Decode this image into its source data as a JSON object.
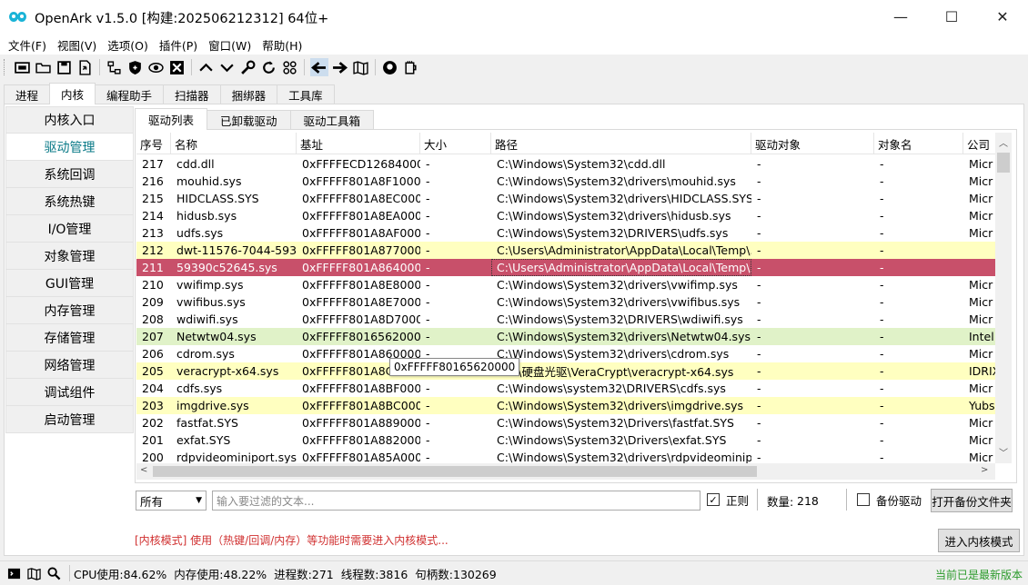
{
  "title": "OpenArk v1.5.0 [构建:202506212312]  64位+",
  "menu": [
    "文件(F)",
    "视图(V)",
    "选项(O)",
    "插件(P)",
    "窗口(W)",
    "帮助(H)"
  ],
  "main_tabs": [
    "进程",
    "内核",
    "编程助手",
    "扫描器",
    "捆绑器",
    "工具库"
  ],
  "main_tab_active": 1,
  "nav": [
    "内核入口",
    "驱动管理",
    "系统回调",
    "系统热键",
    "I/O管理",
    "对象管理",
    "GUI管理",
    "内存管理",
    "存储管理",
    "网络管理",
    "调试组件",
    "启动管理"
  ],
  "nav_active": 1,
  "sub_tabs": [
    "驱动列表",
    "已卸载驱动",
    "驱动工具箱"
  ],
  "sub_tab_active": 0,
  "columns": [
    "序号",
    "名称",
    "基址",
    "大小",
    "路径",
    "驱动对象",
    "对象名",
    "公司"
  ],
  "rows": [
    {
      "no": "217",
      "name": "cdd.dll",
      "base": "0xFFFFECD126840000",
      "size": "-",
      "path": "C:\\Windows\\System32\\cdd.dll",
      "obj": "-",
      "oname": "-",
      "co": "Micr",
      "hl": ""
    },
    {
      "no": "216",
      "name": "mouhid.sys",
      "base": "0xFFFFF801A8F10000",
      "size": "-",
      "path": "C:\\Windows\\System32\\drivers\\mouhid.sys",
      "obj": "-",
      "oname": "-",
      "co": "Micr",
      "hl": ""
    },
    {
      "no": "215",
      "name": "HIDCLASS.SYS",
      "base": "0xFFFFF801A8EC0000",
      "size": "-",
      "path": "C:\\Windows\\System32\\drivers\\HIDCLASS.SYS",
      "obj": "-",
      "oname": "-",
      "co": "Micr",
      "hl": ""
    },
    {
      "no": "214",
      "name": "hidusb.sys",
      "base": "0xFFFFF801A8EA0000",
      "size": "-",
      "path": "C:\\Windows\\System32\\drivers\\hidusb.sys",
      "obj": "-",
      "oname": "-",
      "co": "Micr",
      "hl": ""
    },
    {
      "no": "213",
      "name": "udfs.sys",
      "base": "0xFFFFF801A8AF0000",
      "size": "-",
      "path": "C:\\Windows\\System32\\DRIVERS\\udfs.sys",
      "obj": "-",
      "oname": "-",
      "co": "Micr",
      "hl": ""
    },
    {
      "no": "212",
      "name": "dwt-11576-7044-593...",
      "base": "0xFFFFF801A8770000",
      "size": "-",
      "path": "C:\\Users\\Administrator\\AppData\\Local\\Temp\\...",
      "obj": "-",
      "oname": "-",
      "co": "",
      "hl": "yellow"
    },
    {
      "no": "211",
      "name": "59390c52645.sys",
      "base": "0xFFFFF801A8640000",
      "size": "-",
      "path": "C:\\Users\\Administrator\\AppData\\Local\\Temp\\...",
      "obj": "-",
      "oname": "-",
      "co": "",
      "hl": "red"
    },
    {
      "no": "210",
      "name": "vwifimp.sys",
      "base": "0xFFFFF801A8E80000",
      "size": "-",
      "path": "C:\\Windows\\System32\\drivers\\vwifimp.sys",
      "obj": "-",
      "oname": "-",
      "co": "Micr",
      "hl": ""
    },
    {
      "no": "209",
      "name": "vwifibus.sys",
      "base": "0xFFFFF801A8E70000",
      "size": "-",
      "path": "C:\\Windows\\System32\\drivers\\vwifibus.sys",
      "obj": "-",
      "oname": "-",
      "co": "Micr",
      "hl": ""
    },
    {
      "no": "208",
      "name": "wdiwifi.sys",
      "base": "0xFFFFF801A8D70000",
      "size": "-",
      "path": "C:\\Windows\\System32\\DRIVERS\\wdiwifi.sys",
      "obj": "-",
      "oname": "-",
      "co": "Micr",
      "hl": ""
    },
    {
      "no": "207",
      "name": "Netwtw04.sys",
      "base": "0xFFFFF80165620000",
      "size": "-",
      "path": "C:\\Windows\\System32\\drivers\\Netwtw04.sys",
      "obj": "-",
      "oname": "-",
      "co": "Intel",
      "hl": "green"
    },
    {
      "no": "206",
      "name": "cdrom.sys",
      "base": "0xFFFFF801A8600000",
      "size": "-",
      "path": "C:\\Windows\\System32\\drivers\\cdrom.sys",
      "obj": "-",
      "oname": "-",
      "co": "Micr",
      "hl": ""
    },
    {
      "no": "205",
      "name": "veracrypt-x64.sys",
      "base": "0xFFFFF801A8C9",
      "size": "",
      "path": "soft\\硬盘光驱\\VeraCrypt\\veracrypt-x64.sys",
      "obj": "-",
      "oname": "-",
      "co": "IDRIX",
      "hl": "yellow"
    },
    {
      "no": "204",
      "name": "cdfs.sys",
      "base": "0xFFFFF801A8BF0000",
      "size": "-",
      "path": "C:\\Windows\\system32\\DRIVERS\\cdfs.sys",
      "obj": "-",
      "oname": "-",
      "co": "Micr",
      "hl": ""
    },
    {
      "no": "203",
      "name": "imgdrive.sys",
      "base": "0xFFFFF801A8BC0000",
      "size": "-",
      "path": "C:\\Windows\\System32\\drivers\\imgdrive.sys",
      "obj": "-",
      "oname": "-",
      "co": "Yubs",
      "hl": "yellow"
    },
    {
      "no": "202",
      "name": "fastfat.SYS",
      "base": "0xFFFFF801A8890000",
      "size": "-",
      "path": "C:\\Windows\\System32\\Drivers\\fastfat.SYS",
      "obj": "-",
      "oname": "-",
      "co": "Micr",
      "hl": ""
    },
    {
      "no": "201",
      "name": "exfat.SYS",
      "base": "0xFFFFF801A8820000",
      "size": "-",
      "path": "C:\\Windows\\System32\\Drivers\\exfat.SYS",
      "obj": "-",
      "oname": "-",
      "co": "Micr",
      "hl": ""
    },
    {
      "no": "200",
      "name": "rdpvideominiport.sys",
      "base": "0xFFFFF801A85A0000",
      "size": "-",
      "path": "C:\\Windows\\System32\\drivers\\rdpvideominip...",
      "obj": "-",
      "oname": "-",
      "co": "Micr",
      "hl": ""
    }
  ],
  "tooltip": "0xFFFFF80165620000",
  "filter": {
    "select_value": "所有",
    "placeholder": "输入要过滤的文本...",
    "regex_label": "正则",
    "regex_checked": true,
    "count_label": "数量:",
    "count_value": "218",
    "backup_label": "备份驱动",
    "backup_checked": false,
    "open_backup_button": "打开备份文件夹"
  },
  "kernel_warning": "[内核模式] 使用（热键/回调/内存）等功能时需要进入内核模式...",
  "enter_kernel_button": "进入内核模式",
  "status": {
    "cpu": "CPU使用:84.62%",
    "mem": "内存使用:48.22%",
    "proc": "进程数:271",
    "thread": "线程数:3816",
    "handle": "句柄数:130269",
    "version": "当前已是最新版本"
  },
  "colors": {
    "accent": "#0a7a87",
    "row_yellow": "#ffffc0",
    "row_green": "#e0f2c8",
    "row_red": "#c8506a",
    "warning": "#d03030",
    "status_ok": "#2a9a2a"
  }
}
